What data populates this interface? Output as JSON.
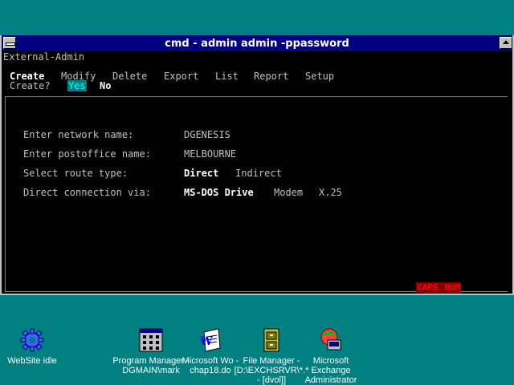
{
  "window": {
    "title": "cmd - admin admin -ppassword",
    "app_name": "External-Admin"
  },
  "menu": {
    "items": [
      {
        "label": "Create",
        "active": true
      },
      {
        "label": "Modify",
        "active": false
      },
      {
        "label": "Delete",
        "active": false
      },
      {
        "label": "Export",
        "active": false
      },
      {
        "label": "List",
        "active": false
      },
      {
        "label": "Report",
        "active": false
      },
      {
        "label": "Setup",
        "active": false
      }
    ]
  },
  "prompt": {
    "question": "Create?",
    "yes": "Yes",
    "no": "No"
  },
  "form": {
    "network_label": "Enter network name:",
    "network_value": "DGENESIS",
    "postoffice_label": "Enter postoffice name:",
    "postoffice_value": "MELBOURNE",
    "route_label": "Select route type:",
    "route_options": [
      "Direct",
      "Indirect"
    ],
    "connection_label": "Direct connection via:",
    "connection_options": [
      "MS-DOS Drive",
      "Modem",
      "X.25"
    ]
  },
  "status": {
    "caps": "CAPS",
    "num": "NUM"
  },
  "desktop": {
    "icons": [
      {
        "name": "website",
        "icon": "gear-icon",
        "label": "WebSite idle"
      },
      {
        "name": "program-manager",
        "icon": "program-manager-icon",
        "label": "Program Manager - DGMAIN\\mark"
      },
      {
        "name": "word",
        "icon": "word-document-icon",
        "label": "Microsoft Wo - chap18.do"
      },
      {
        "name": "file-manager",
        "icon": "file-cabinet-icon",
        "label": "File Manager - [D:\\EXCHSRVR\\*.* - [dvol]]"
      },
      {
        "name": "exchange",
        "icon": "exchange-admin-icon",
        "label": "Microsoft Exchange Administrator"
      }
    ]
  },
  "colors": {
    "desktop": "#008080",
    "titlebar": "#000080",
    "terminal_bg": "#000000",
    "highlight_yes": "#00ffff",
    "status": "#ff0000"
  }
}
